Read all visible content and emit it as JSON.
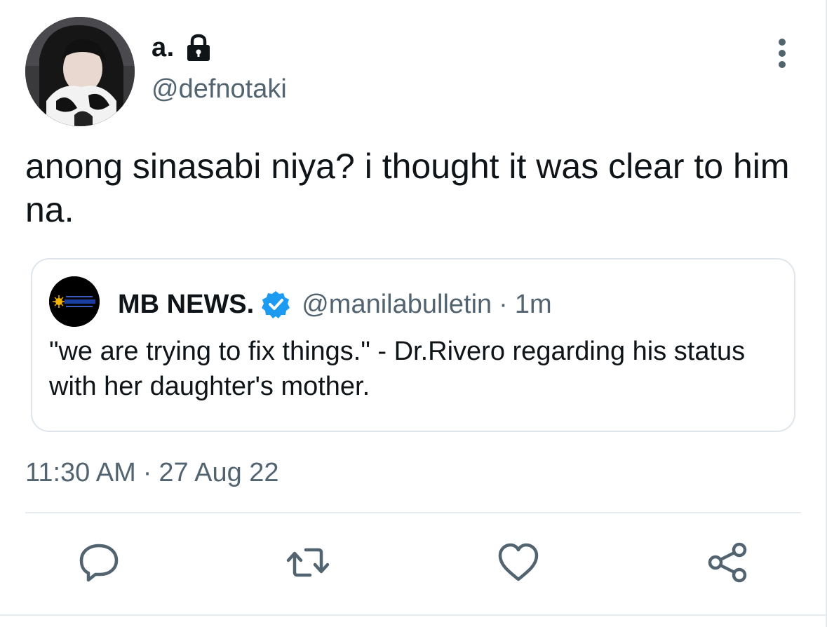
{
  "tweet": {
    "author": {
      "display_name": "a.",
      "handle": "@defnotaki",
      "avatar_icon": "profile-photo",
      "protected_icon": "lock-icon"
    },
    "text": "anong sinasabi niya? i thought it was clear to him na.",
    "timestamp": {
      "time": "11:30 AM",
      "separator": "·",
      "date": "27 Aug 22"
    }
  },
  "quoted_tweet": {
    "author": {
      "display_name": "MB NEWS.",
      "handle": "@manilabulletin",
      "verified_icon": "verified-badge-icon",
      "avatar_icon": "manila-bulletin-logo"
    },
    "separator": "·",
    "time_ago": "1m",
    "text": "\"we are trying to fix things.\" - Dr.Rivero regarding his status with her daughter's mother."
  },
  "actions": [
    {
      "name": "reply",
      "icon": "reply-icon"
    },
    {
      "name": "retweet",
      "icon": "retweet-icon"
    },
    {
      "name": "like",
      "icon": "heart-icon"
    },
    {
      "name": "share",
      "icon": "share-icon"
    }
  ],
  "colors": {
    "text_primary": "#0f1419",
    "text_secondary": "#536471",
    "border": "#dfe5ea",
    "verified": "#1d9bf0",
    "icon": "#536471"
  }
}
